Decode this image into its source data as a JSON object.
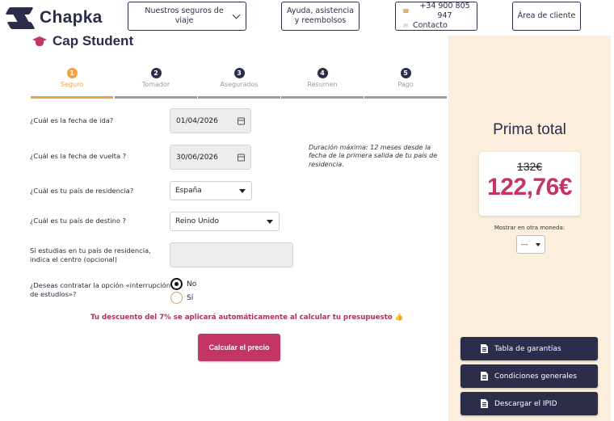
{
  "brand": {
    "name": "Chapka"
  },
  "header": {
    "nav_label": "Nuestros seguros de viaje",
    "help_line1": "Ayuda, asistencia",
    "help_line2": "y reembolsos",
    "phone": "+34 900 805 947",
    "contact": "Contacto",
    "client_area": "Área de cliente"
  },
  "product": {
    "title": "Cap Student"
  },
  "steps": [
    {
      "num": "1",
      "label": "Seguro",
      "active": true
    },
    {
      "num": "2",
      "label": "Tomador",
      "active": false
    },
    {
      "num": "3",
      "label": "Asegurados",
      "active": false
    },
    {
      "num": "4",
      "label": "Resumen",
      "active": false
    },
    {
      "num": "5",
      "label": "Pago",
      "active": false
    }
  ],
  "form": {
    "departure": {
      "label": "¿Cuál es la fecha de ida?",
      "value": "01/04/2026"
    },
    "return": {
      "label": "¿Cuál es la fecha de vuelta ?",
      "value": "30/06/2026"
    },
    "duration_note": "Duración máxima: 12 meses desde la fecha de la primera salida de tu país de residencia.",
    "residence": {
      "label": "¿Cuál es tu país de residencia?",
      "value": "España"
    },
    "destination": {
      "label": "¿Cuál es tu país de destino ?",
      "value": "Reino Unido"
    },
    "study_center": {
      "label_line1": "Si estudias en tu país de residencia,",
      "label_line2": "indica el centro (opcional)",
      "value": ""
    },
    "interruption": {
      "label_line1": "¿Deseas contratar la opción «interrupción",
      "label_line2": "de estudios»?",
      "options": [
        "No",
        "Sí"
      ],
      "selected": "No"
    },
    "discount_text": "Tu descuento del 7% se aplicará automáticamente al calcular tu presupuesto",
    "discount_emoji": "👍",
    "calculate_button": "Calcular el precio"
  },
  "sidebar": {
    "total_label": "Prima total",
    "old_price": "132€",
    "new_price": "122,76€",
    "currency_label": "Mostrar en otra moneda:",
    "currency_value": "---",
    "buttons": [
      "Tabla de garantías",
      "Condiciones generales",
      "Descargar el IPID"
    ]
  },
  "colors": {
    "navy": "#2b2d4a",
    "accent_pink": "#c23566",
    "step_active": "#f0a243",
    "sidebar_bg": "#fbeedc"
  }
}
